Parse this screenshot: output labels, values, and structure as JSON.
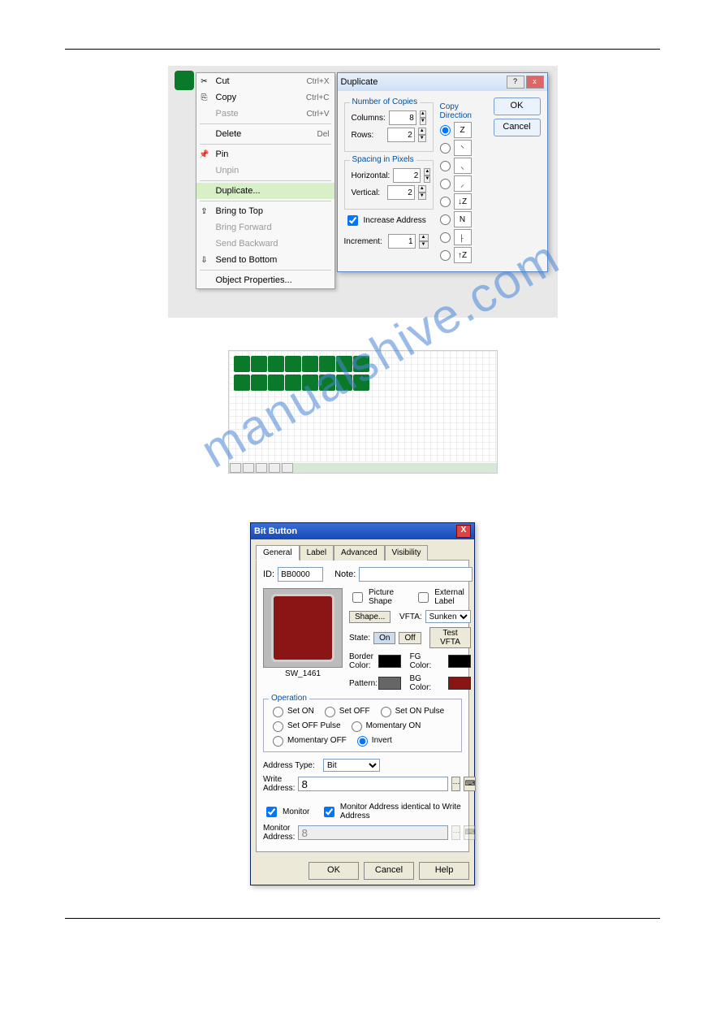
{
  "context_menu": {
    "items": [
      {
        "icon": "✂",
        "label": "Cut",
        "shortcut": "Ctrl+X",
        "disabled": false
      },
      {
        "icon": "⎘",
        "label": "Copy",
        "shortcut": "Ctrl+C",
        "disabled": false
      },
      {
        "icon": "",
        "label": "Paste",
        "shortcut": "Ctrl+V",
        "disabled": true
      },
      {
        "icon": "",
        "label": "Delete",
        "shortcut": "Del",
        "disabled": false
      },
      {
        "icon": "📌",
        "label": "Pin",
        "shortcut": "",
        "disabled": false
      },
      {
        "icon": "",
        "label": "Unpin",
        "shortcut": "",
        "disabled": true
      },
      {
        "icon": "",
        "label": "Duplicate...",
        "shortcut": "",
        "disabled": false,
        "highlight": true
      },
      {
        "icon": "⇪",
        "label": "Bring to Top",
        "shortcut": "",
        "disabled": false
      },
      {
        "icon": "",
        "label": "Bring Forward",
        "shortcut": "",
        "disabled": true
      },
      {
        "icon": "",
        "label": "Send Backward",
        "shortcut": "",
        "disabled": true
      },
      {
        "icon": "⇩",
        "label": "Send to Bottom",
        "shortcut": "",
        "disabled": false
      },
      {
        "icon": "",
        "label": "Object Properties...",
        "shortcut": "",
        "disabled": false
      }
    ],
    "separators_after": [
      2,
      3,
      5,
      6,
      10
    ]
  },
  "duplicate_dialog": {
    "title": "Duplicate",
    "groups": {
      "copies": {
        "title": "Number of Copies",
        "columns_label": "Columns:",
        "columns": "8",
        "rows_label": "Rows:",
        "rows": "2"
      },
      "spacing": {
        "title": "Spacing in Pixels",
        "horiz_label": "Horizontal:",
        "horiz": "2",
        "vert_label": "Vertical:",
        "vert": "2"
      },
      "increase": {
        "checkbox": "Increase Address",
        "increment_label": "Increment:",
        "increment": "1"
      },
      "direction": {
        "title": "Copy Direction",
        "glyphs": [
          "Z",
          "⸌",
          "⸜",
          "⸝",
          "↓Z",
          "N",
          "⸠",
          "↑Z"
        ]
      }
    },
    "buttons": {
      "ok": "OK",
      "cancel": "Cancel"
    }
  },
  "bit_button_dialog": {
    "title": "Bit Button",
    "tabs": [
      "General",
      "Label",
      "Advanced",
      "Visibility"
    ],
    "id_label": "ID:",
    "id_value": "BB0000",
    "note_label": "Note:",
    "note_value": "",
    "checkboxes": {
      "picture_shape": "Picture Shape",
      "external_label": "External Label"
    },
    "shape_btn": "Shape...",
    "vfta_label": "VFTA:",
    "vfta_value": "Sunken",
    "state_label": "State:",
    "state_on": "On",
    "state_off": "Off",
    "test_vfta": "Test VFTA",
    "border_label": "Border Color:",
    "fg_label": "FG Color:",
    "pattern_label": "Pattern:",
    "bg_label": "BG Color:",
    "preview_name": "SW_1461",
    "colors": {
      "border": "#000000",
      "fg": "#000000",
      "bg": "#8a1515",
      "pattern": "#666"
    },
    "operation": {
      "title": "Operation",
      "options": [
        "Set ON",
        "Set OFF",
        "Set ON Pulse",
        "Set OFF Pulse",
        "Momentary ON",
        "Momentary OFF",
        "Invert"
      ],
      "selected": "Invert"
    },
    "address": {
      "type_label": "Address Type:",
      "type_value": "Bit",
      "write_label": "Write Address:",
      "write_value": "8",
      "monitor_chk": "Monitor",
      "monitor_ident_chk": "Monitor Address identical to Write Address",
      "monitor_label": "Monitor Address:",
      "monitor_value": "8"
    },
    "buttons": {
      "ok": "OK",
      "cancel": "Cancel",
      "help": "Help"
    }
  },
  "watermark": "manualshive.com"
}
